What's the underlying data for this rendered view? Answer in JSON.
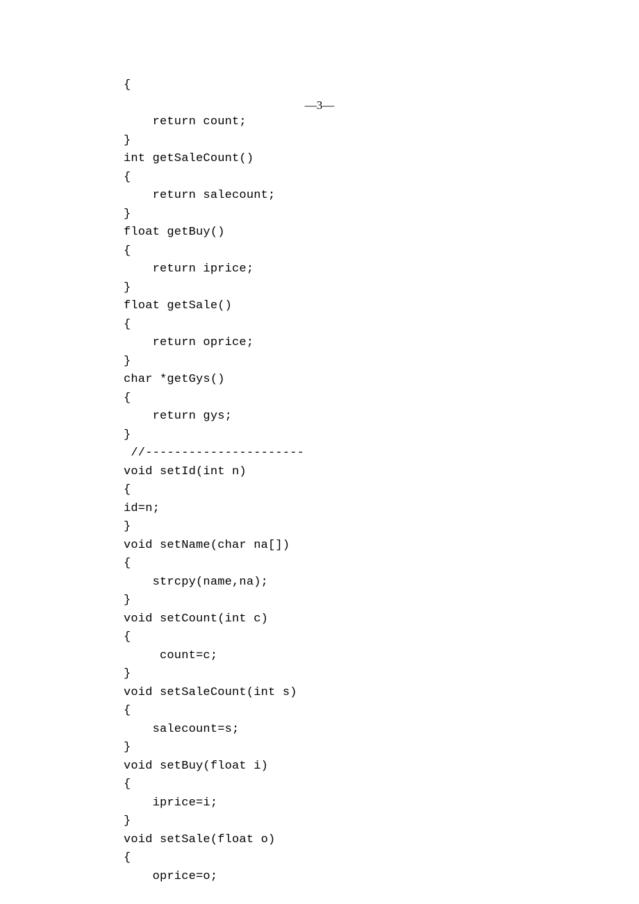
{
  "page_number": "—3—",
  "code": "{\n\n    return count;\n}\nint getSaleCount()\n{\n    return salecount;\n}\nfloat getBuy()\n{\n    return iprice;\n}\nfloat getSale()\n{\n    return oprice;\n}\nchar *getGys()\n{\n    return gys;\n}\n //----------------------\nvoid setId(int n)\n{\nid=n;\n}\nvoid setName(char na[])\n{\n    strcpy(name,na);\n}\nvoid setCount(int c)\n{\n     count=c;\n}\nvoid setSaleCount(int s)\n{\n    salecount=s;\n}\nvoid setBuy(float i)\n{\n    iprice=i;\n}\nvoid setSale(float o)\n{\n    oprice=o;"
}
